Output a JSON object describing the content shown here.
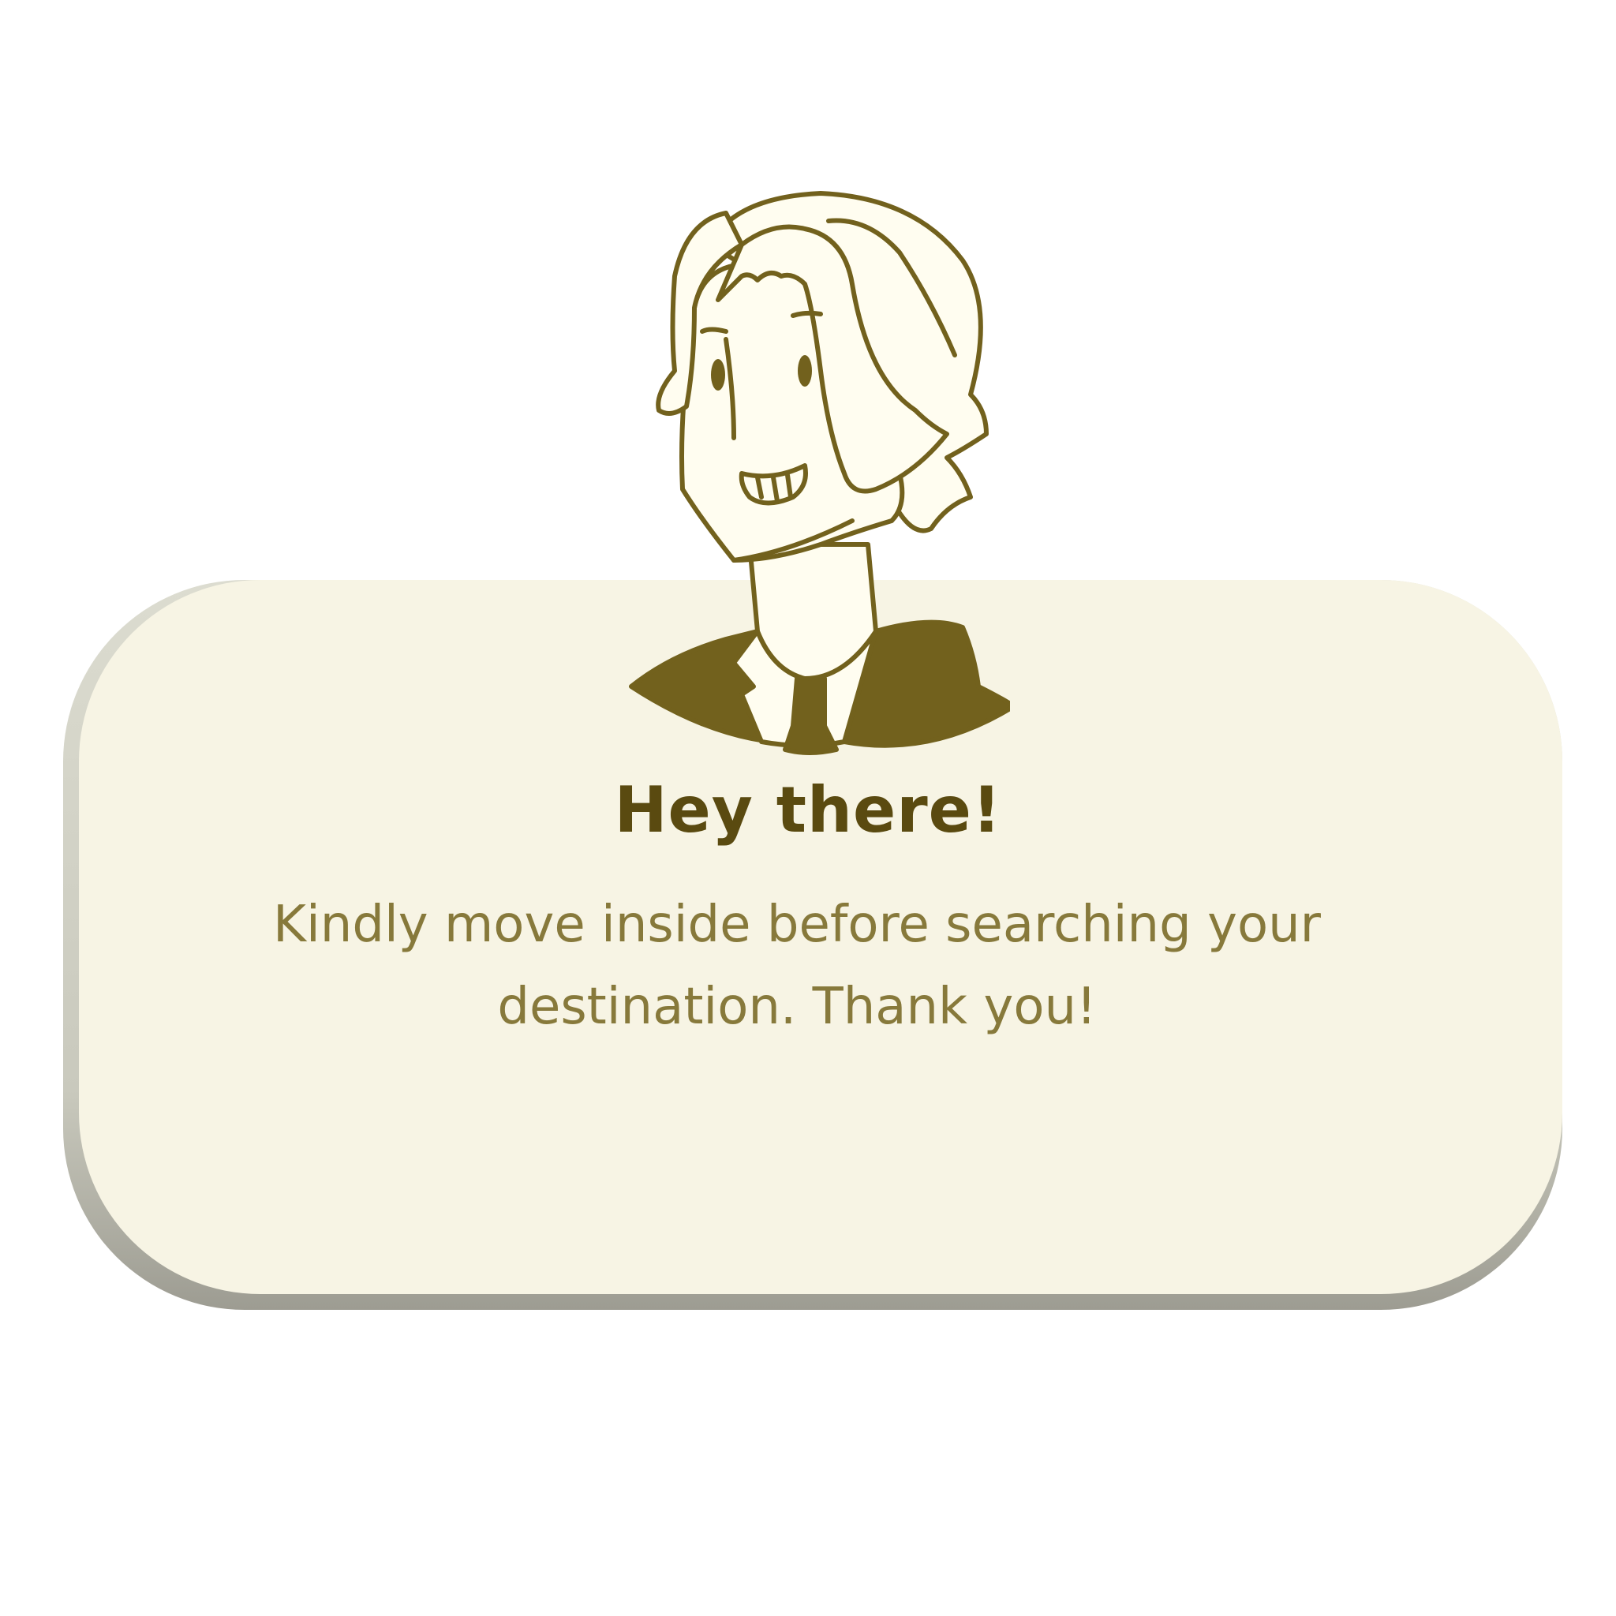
{
  "dialog": {
    "title": "Hey there!",
    "message": "Kindly move inside before searching your destination. Thank you!"
  },
  "colors": {
    "card": "#f7f4e4",
    "title": "#5a4a10",
    "message": "#87793b",
    "line": "#72611d",
    "skin": "#fffdf0"
  },
  "icons": {
    "avatar": "person-avatar-icon"
  }
}
